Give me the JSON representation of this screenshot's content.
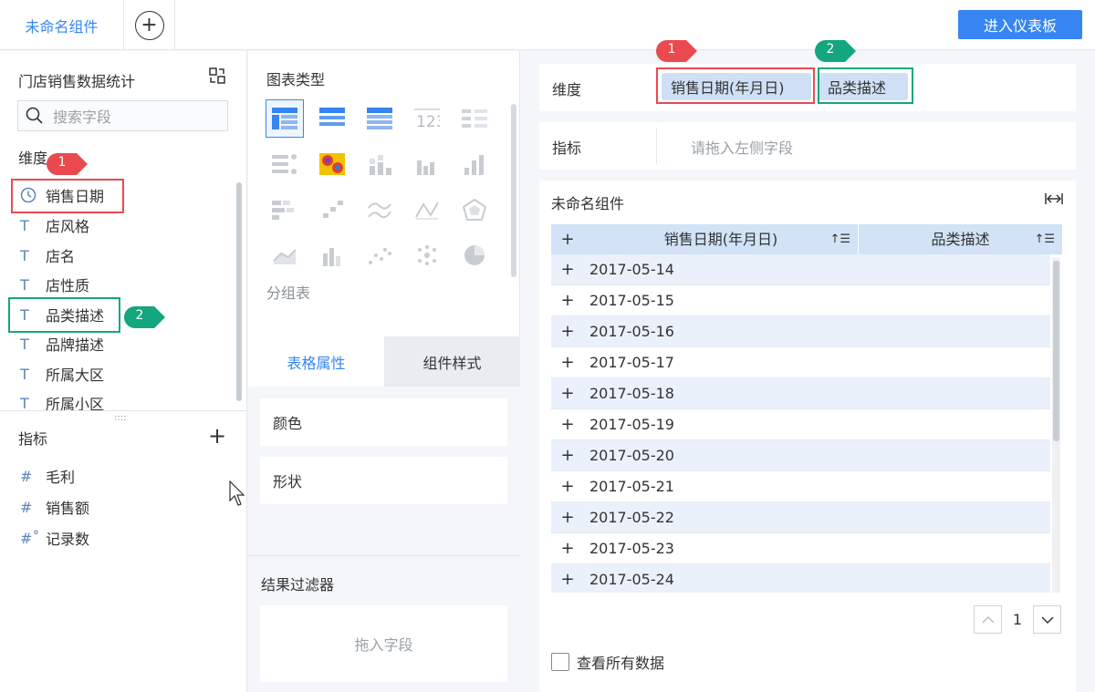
{
  "topbar": {
    "tab_label": "未命名组件",
    "add_symbol": "+",
    "enter_button": "进入仪表板"
  },
  "left": {
    "dataset_title": "门店销售数据统计",
    "search_placeholder": "搜索字段",
    "dimension_label": "维度",
    "dimensions": [
      {
        "icon": "clock",
        "glyph": "◷",
        "name": "销售日期"
      },
      {
        "icon": "text",
        "glyph": "T",
        "name": "店风格"
      },
      {
        "icon": "text",
        "glyph": "T",
        "name": "店名"
      },
      {
        "icon": "text",
        "glyph": "T",
        "name": "店性质"
      },
      {
        "icon": "text",
        "glyph": "T",
        "name": "品类描述"
      },
      {
        "icon": "text",
        "glyph": "T",
        "name": "品牌描述"
      },
      {
        "icon": "text",
        "glyph": "T",
        "name": "所属大区"
      },
      {
        "icon": "text",
        "glyph": "T",
        "name": "所属小区"
      }
    ],
    "indicator_label": "指标",
    "indicator_add": "+",
    "indicators": [
      {
        "glyph": "#",
        "name": "毛利"
      },
      {
        "glyph": "#",
        "name": "销售额"
      },
      {
        "glyph": "#˚",
        "name": "记录数"
      }
    ],
    "grip": "::::"
  },
  "middle": {
    "chart_type_title": "图表类型",
    "group_label": "分组表",
    "tabs": {
      "table_props": "表格属性",
      "component_style": "组件样式"
    },
    "props": {
      "color": "颜色",
      "shape": "形状"
    },
    "filter_title": "结果过滤器",
    "filter_placeholder": "拖入字段"
  },
  "right": {
    "dimension_label": "维度",
    "dimension_pills": [
      "销售日期(年月日)",
      "品类描述"
    ],
    "indicator_label": "指标",
    "indicator_placeholder": "请拖入左侧字段",
    "widget_title": "未命名组件",
    "expand_symbol": "|↔|",
    "table": {
      "headers": [
        "销售日期(年月日)",
        "品类描述"
      ],
      "rows": [
        "2017-05-14",
        "2017-05-15",
        "2017-05-16",
        "2017-05-17",
        "2017-05-18",
        "2017-05-19",
        "2017-05-20",
        "2017-05-21",
        "2017-05-22",
        "2017-05-23",
        "2017-05-24"
      ]
    },
    "page_number": "1",
    "view_all": "查看所有数据"
  },
  "badges": {
    "one": "1",
    "two": "2"
  },
  "colors": {
    "accent": "#3685f2",
    "red_box": "#e94a4f",
    "green_box": "#13a67f",
    "pill_bg": "#cfe0f5",
    "header_bg": "#d2e3f8"
  }
}
